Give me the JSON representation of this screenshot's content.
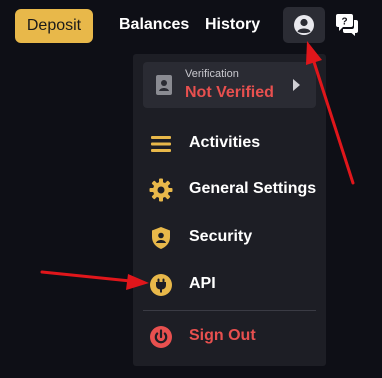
{
  "header": {
    "deposit_label": "Deposit",
    "nav": {
      "balances": "Balances",
      "history": "History"
    }
  },
  "menu": {
    "verification": {
      "caption": "Verification",
      "status": "Not Verified"
    },
    "items": [
      {
        "label": "Activities",
        "icon": "list-icon"
      },
      {
        "label": "General Settings",
        "icon": "gear-icon"
      },
      {
        "label": "Security",
        "icon": "shield-user-icon"
      },
      {
        "label": "API",
        "icon": "plug-icon"
      }
    ],
    "signout_label": "Sign Out"
  },
  "colors": {
    "accent": "#e8b84a",
    "danger": "#e8504f",
    "menu_bg": "#1d1e25",
    "card_bg": "#2a2b33",
    "page_bg": "#0e0f16",
    "annotation_arrow": "#e0161b"
  }
}
